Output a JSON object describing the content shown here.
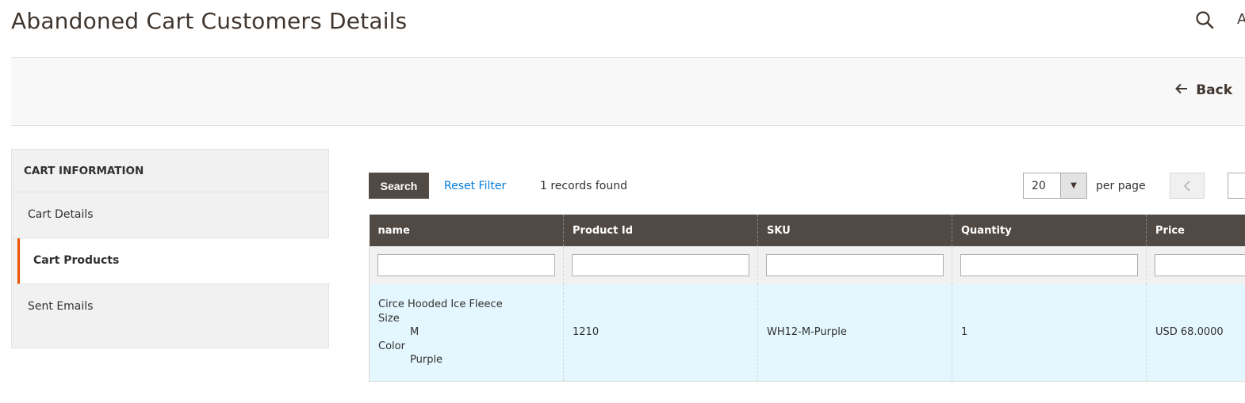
{
  "header": {
    "title": "Abandoned Cart Customers Details",
    "search_icon": "search-icon",
    "cut_text": "A"
  },
  "action_bar": {
    "back_label": "Back",
    "back_icon": "arrow-left-icon"
  },
  "sidebar": {
    "title": "CART INFORMATION",
    "items": [
      {
        "label": "Cart Details",
        "active": false
      },
      {
        "label": "Cart Products",
        "active": true
      },
      {
        "label": "Sent Emails",
        "active": false
      }
    ],
    "accent_color": "#eb5202"
  },
  "toolbar": {
    "search_label": "Search",
    "reset_label": "Reset Filter",
    "records_found": "1 records found",
    "per_page_value": "20",
    "per_page_label": "per page"
  },
  "grid": {
    "columns": [
      "name",
      "Product Id",
      "SKU",
      "Quantity",
      "Price"
    ],
    "rows": [
      {
        "name": "Circe Hooded Ice Fleece",
        "options": [
          {
            "label": "Size",
            "value": "M"
          },
          {
            "label": "Color",
            "value": "Purple"
          }
        ],
        "product_id": "1210",
        "sku": "WH12-M-Purple",
        "quantity": "1",
        "price": "USD 68.0000"
      }
    ]
  },
  "colors": {
    "header_bg": "#514943",
    "row_highlight": "#e5f7fe",
    "link": "#007bdb"
  }
}
